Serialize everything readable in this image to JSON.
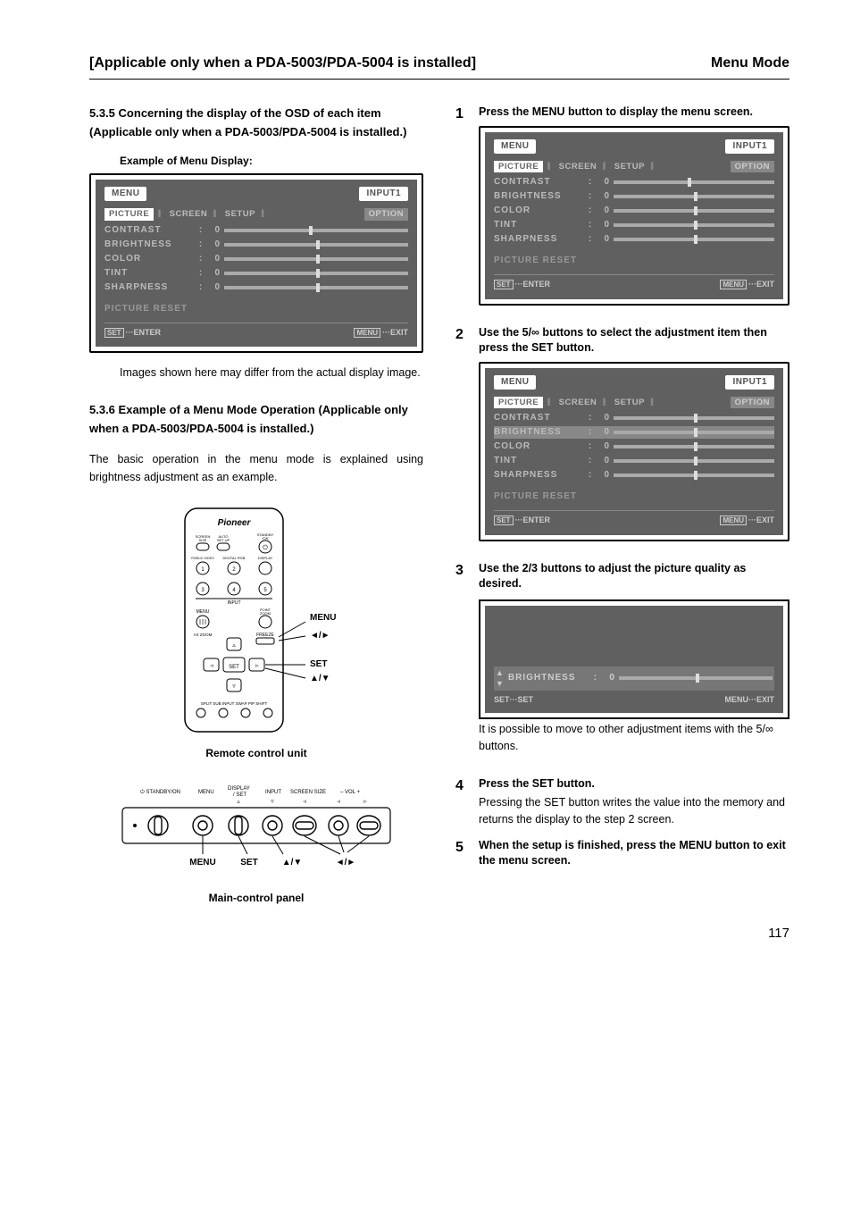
{
  "header": {
    "left": "[Applicable only when a PDA-5003/PDA-5004 is installed]",
    "right": "Menu Mode"
  },
  "section535": {
    "num": "5.3.5",
    "title": "Concerning the display of the OSD of each item (Applicable only when a PDA-5003/PDA-5004 is installed.)",
    "example_label": "Example of Menu Display:",
    "note": "Images shown here may differ from the actual display image."
  },
  "section536": {
    "num": "5.3.6",
    "title": "Example of a Menu Mode Operation (Applicable only when a PDA-5003/PDA-5004 is installed.)",
    "intro": "The basic operation in the menu mode is explained using brightness adjustment as an example."
  },
  "menu_screen": {
    "menu_label": "MENU",
    "input_label": "INPUT1",
    "tabs": {
      "picture": "PICTURE",
      "screen": "SCREEN",
      "setup": "SETUP",
      "option": "OPTION"
    },
    "rows": [
      {
        "label": "CONTRAST",
        "val": "0"
      },
      {
        "label": "BRIGHTNESS",
        "val": "0"
      },
      {
        "label": "COLOR",
        "val": "0"
      },
      {
        "label": "TINT",
        "val": "0"
      },
      {
        "label": "SHARPNESS",
        "val": "0"
      }
    ],
    "reset": "PICTURE RESET",
    "foot_set": "SET",
    "foot_set_suffix": "···ENTER",
    "foot_menu": "MENU",
    "foot_menu_suffix": "···EXIT"
  },
  "adjust_screen": {
    "label": "BRIGHTNESS",
    "val": "0",
    "foot_set": "SET",
    "foot_set_suffix": "···SET",
    "foot_menu": "MENU",
    "foot_menu_suffix": "···EXIT"
  },
  "remote": {
    "caption": "Remote control unit",
    "labels": {
      "menu": "MENU",
      "lr": "2/3",
      "set": "SET",
      "ud": "5/∞"
    },
    "brand": "Pioneer",
    "btn_standby": "STANDBY/ON",
    "btn_screen": "SCREEN SIZE",
    "btn_auto": "AUTO SET UP",
    "row2a": "RGB1/2~VIDEO",
    "row2b": "DIGITAL RGB",
    "row2c": "DISPLAY",
    "input_lbl": "INPUT",
    "menu_btn": "MENU",
    "point_zoom": "POINT ZOOM",
    "axzoom": "AX ZOOM",
    "freeze": "FREEZE",
    "set_btn": "SET",
    "bottom": "SPLIT SUB INPUT SWAP PIP SHIFT"
  },
  "panel": {
    "caption": "Main-control panel",
    "top_labels": [
      "STANDBY/ON",
      "MENU",
      "DISPLAY / SET",
      "INPUT",
      "SCREEN SIZE",
      "– VOL +"
    ],
    "bottom_labels": {
      "menu": "MENU",
      "set": "SET",
      "ud": "5/∞",
      "lr": "2/3"
    }
  },
  "steps": {
    "s1": {
      "n": "1",
      "lead": "Press the MENU button to display the menu screen."
    },
    "s2": {
      "n": "2",
      "lead": "Use the 5/∞ buttons to select the adjustment item then press the SET button."
    },
    "s3": {
      "n": "3",
      "lead": "Use the 2/3 buttons to adjust the picture quality as desired.",
      "note": "It is possible to move to other adjustment items with the 5/∞ buttons."
    },
    "s4": {
      "n": "4",
      "lead": "Press the SET button.",
      "body": "Pressing the SET button writes the value into the memory and returns the display to the step 2 screen."
    },
    "s5": {
      "n": "5",
      "lead": "When the setup is finished, press the MENU button to exit the menu screen."
    }
  },
  "page_number": "117"
}
